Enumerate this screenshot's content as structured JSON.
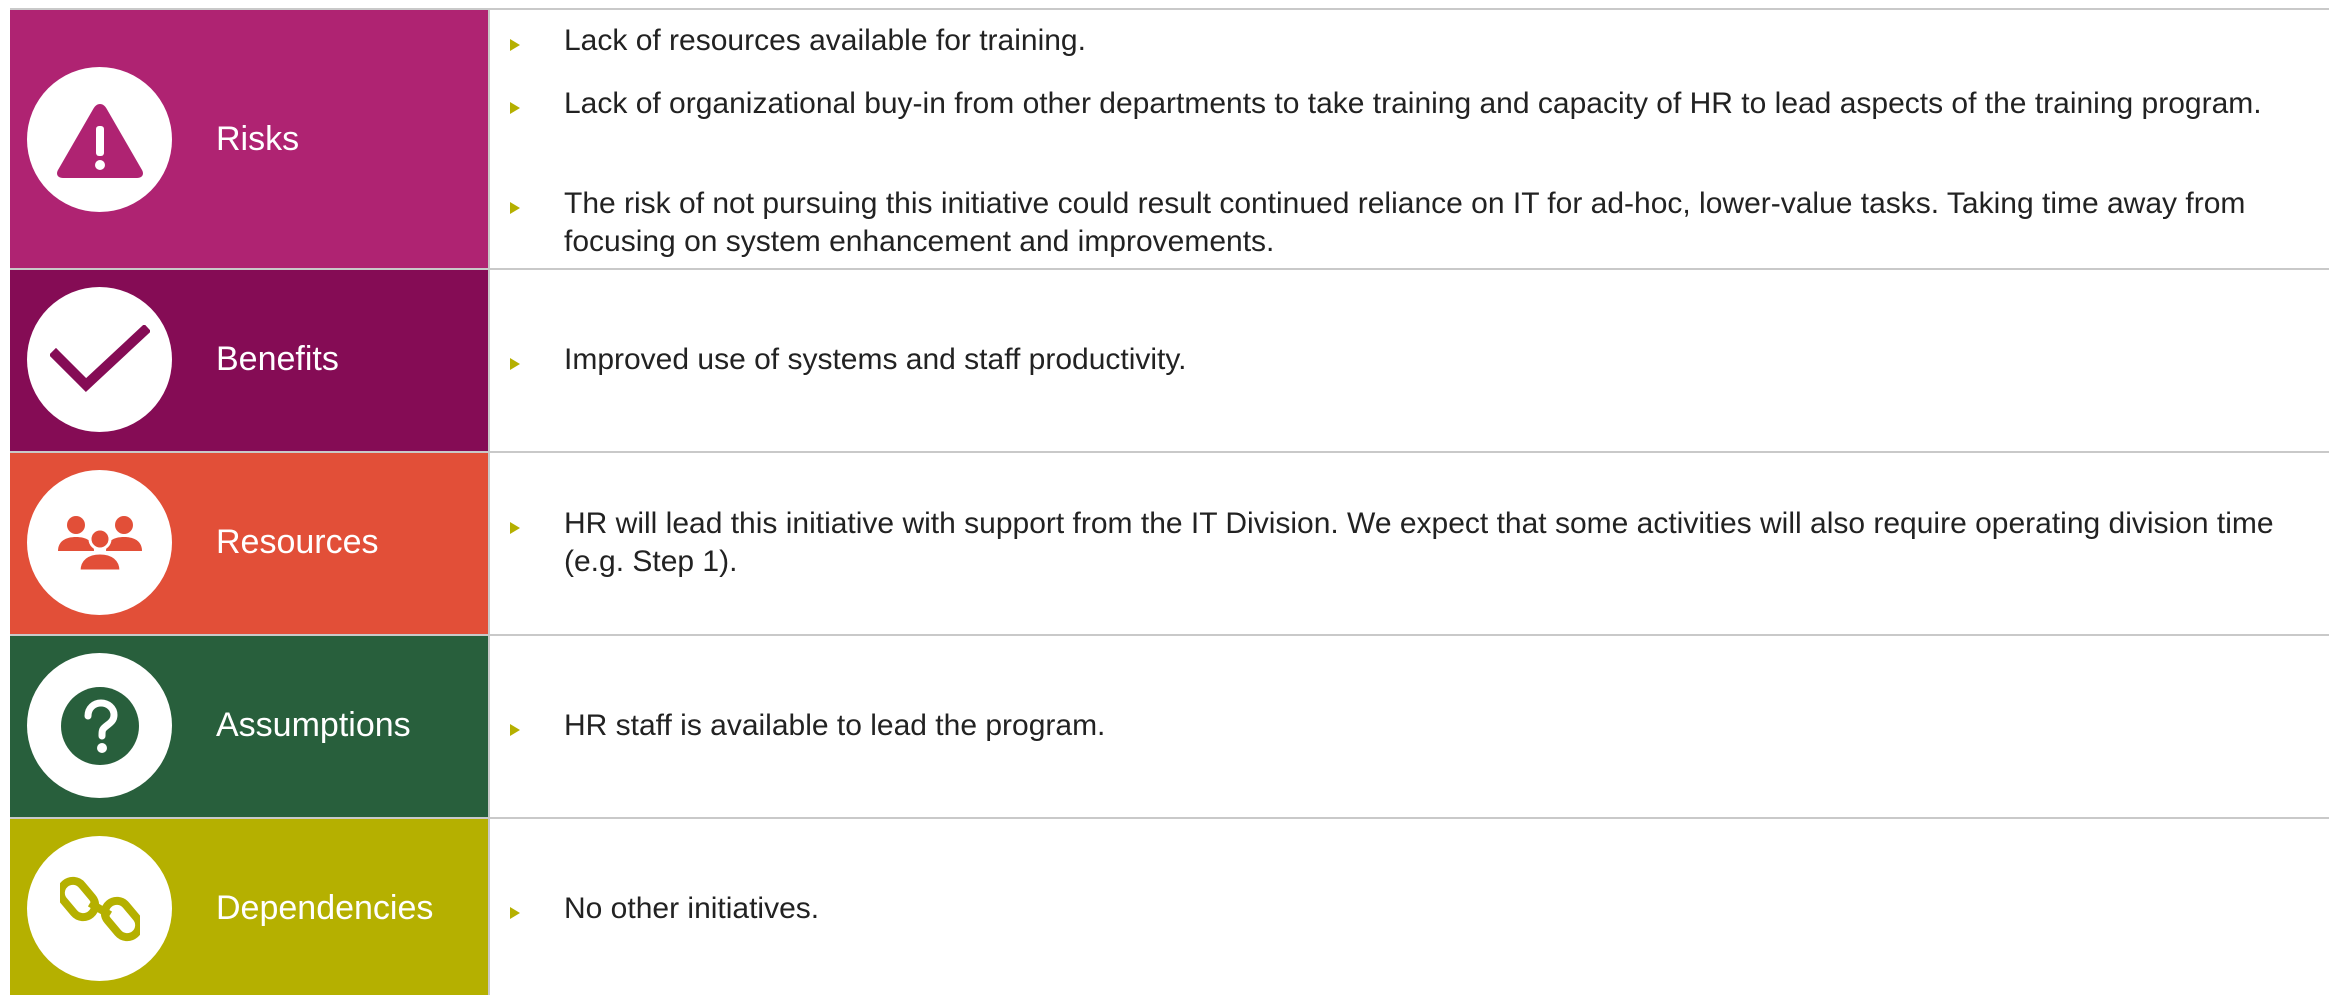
{
  "rows": [
    {
      "key": "risks",
      "label": "Risks",
      "color": "#af2372",
      "icon": "warning-triangle-icon",
      "bullets": [
        "Lack of resources available for training.",
        "Lack of organizational buy-in from other departments to take training and capacity of HR to lead aspects of the training program.",
        "The risk of not pursuing this initiative could result continued reliance on IT for ad-hoc, lower-value tasks. Taking time away from focusing on system enhancement and improvements."
      ]
    },
    {
      "key": "benefits",
      "label": "Benefits",
      "color": "#850c55",
      "icon": "checkmark-icon",
      "bullets": [
        "Improved use of systems and staff productivity."
      ]
    },
    {
      "key": "resources",
      "label": "Resources",
      "color": "#e24f38",
      "icon": "people-group-icon",
      "bullets": [
        "HR will lead this initiative with support from the IT Division. We expect that some activities will also require operating division time (e.g. Step 1)."
      ]
    },
    {
      "key": "assumptions",
      "label": "Assumptions",
      "color": "#285f3c",
      "icon": "question-mark-icon",
      "bullets": [
        "HR staff is available to lead the program."
      ]
    },
    {
      "key": "dependencies",
      "label": "Dependencies",
      "color": "#b5b000",
      "icon": "chain-link-icon",
      "bullets": [
        "No other initiatives."
      ]
    }
  ],
  "bullet_color": "#b5b000",
  "text_color": "#222222",
  "divider_color": "#c9c9c9"
}
